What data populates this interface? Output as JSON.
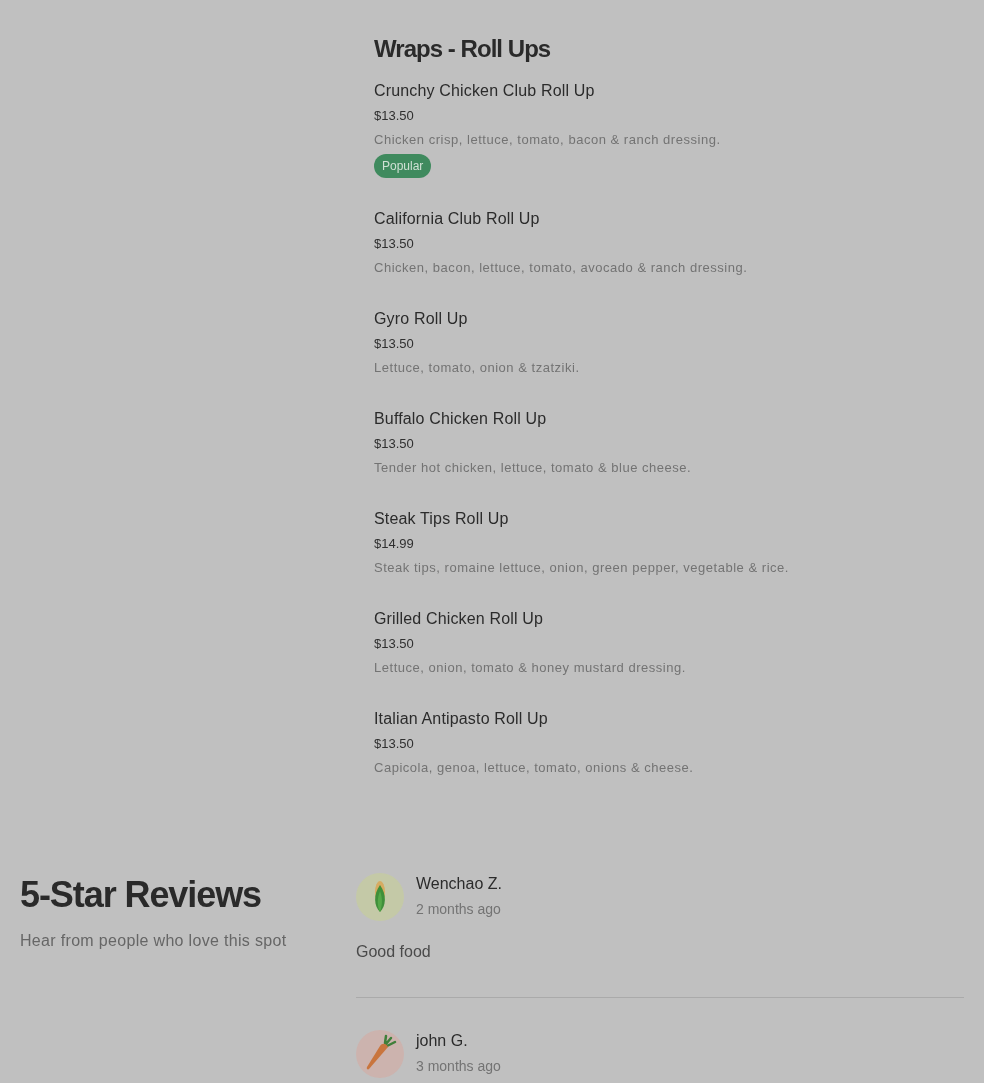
{
  "menu_section": {
    "title": "Wraps - Roll Ups",
    "items": [
      {
        "name": "Crunchy Chicken Club Roll Up",
        "price": "$13.50",
        "description": "Chicken crisp, lettuce, tomato, bacon & ranch dressing.",
        "badge": "Popular"
      },
      {
        "name": "California Club Roll Up",
        "price": "$13.50",
        "description": "Chicken, bacon, lettuce, tomato, avocado & ranch dressing."
      },
      {
        "name": "Gyro Roll Up",
        "price": "$13.50",
        "description": "Lettuce, tomato, onion & tzatziki."
      },
      {
        "name": "Buffalo Chicken Roll Up",
        "price": "$13.50",
        "description": "Tender hot chicken, lettuce, tomato & blue cheese."
      },
      {
        "name": "Steak Tips Roll Up",
        "price": "$14.99",
        "description": "Steak tips, romaine lettuce, onion, green pepper, vegetable & rice."
      },
      {
        "name": "Grilled Chicken Roll Up",
        "price": "$13.50",
        "description": "Lettuce, onion, tomato & honey mustard dressing."
      },
      {
        "name": "Italian Antipasto Roll Up",
        "price": "$13.50",
        "description": "Capicola, genoa, lettuce, tomato, onions & cheese."
      }
    ]
  },
  "reviews": {
    "title": "5-Star Reviews",
    "subtitle": "Hear from people who love this spot",
    "items": [
      {
        "author": "Wenchao Z.",
        "time": "2 months ago",
        "text": "Good food",
        "kind": "corn",
        "color": "#c4c9a7"
      },
      {
        "author": "john G.",
        "time": "3 months ago",
        "kind": "carrot",
        "color": "#ccb3ae"
      }
    ]
  }
}
